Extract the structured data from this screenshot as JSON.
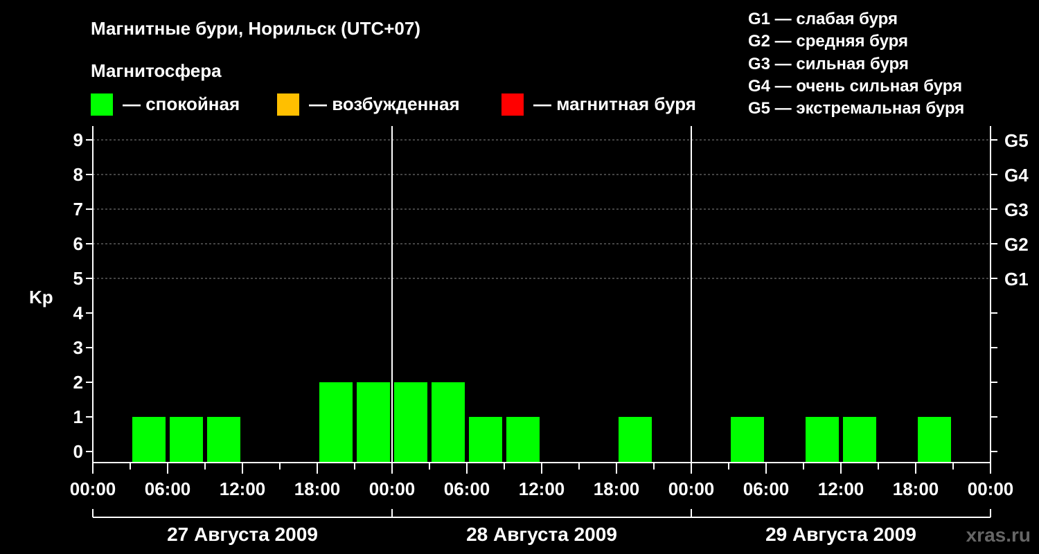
{
  "title": "Магнитные бури, Норильск (UTC+07)",
  "legend": {
    "title": "Магнитосфера",
    "items": [
      {
        "label": "— спокойная",
        "color": "#00ff00"
      },
      {
        "label": "— возбужденная",
        "color": "#ffbf00"
      },
      {
        "label": "— магнитная буря",
        "color": "#ff0000"
      }
    ]
  },
  "storm_scale": [
    "G1 — слабая буря",
    "G2 — средняя буря",
    "G3 — сильная буря",
    "G4 — очень сильная буря",
    "G5 — экстремальная буря"
  ],
  "watermark": "xras.ru",
  "chart_data": {
    "type": "bar",
    "ylabel": "Kp",
    "ylim": [
      0,
      9
    ],
    "yticks": [
      0,
      1,
      2,
      3,
      4,
      5,
      6,
      7,
      8,
      9
    ],
    "right_axis_labels": [
      {
        "kp": 5,
        "label": "G1"
      },
      {
        "kp": 6,
        "label": "G2"
      },
      {
        "kp": 7,
        "label": "G3"
      },
      {
        "kp": 8,
        "label": "G4"
      },
      {
        "kp": 9,
        "label": "G5"
      }
    ],
    "x_tick_labels": [
      "00:00",
      "06:00",
      "12:00",
      "18:00",
      "00:00",
      "06:00",
      "12:00",
      "18:00",
      "00:00",
      "06:00",
      "12:00",
      "18:00",
      "00:00"
    ],
    "days": [
      "27 Августа 2009",
      "28 Августа 2009",
      "29 Августа 2009"
    ],
    "interval_hours": 3,
    "values": [
      0,
      1,
      1,
      1,
      0,
      0,
      2,
      2,
      2,
      2,
      1,
      1,
      0,
      0,
      1,
      0,
      0,
      1,
      0,
      1,
      1,
      0,
      1,
      0
    ],
    "bar_color": "#00ff00",
    "grid_lines_at": [
      5,
      6,
      7,
      8,
      9
    ]
  }
}
